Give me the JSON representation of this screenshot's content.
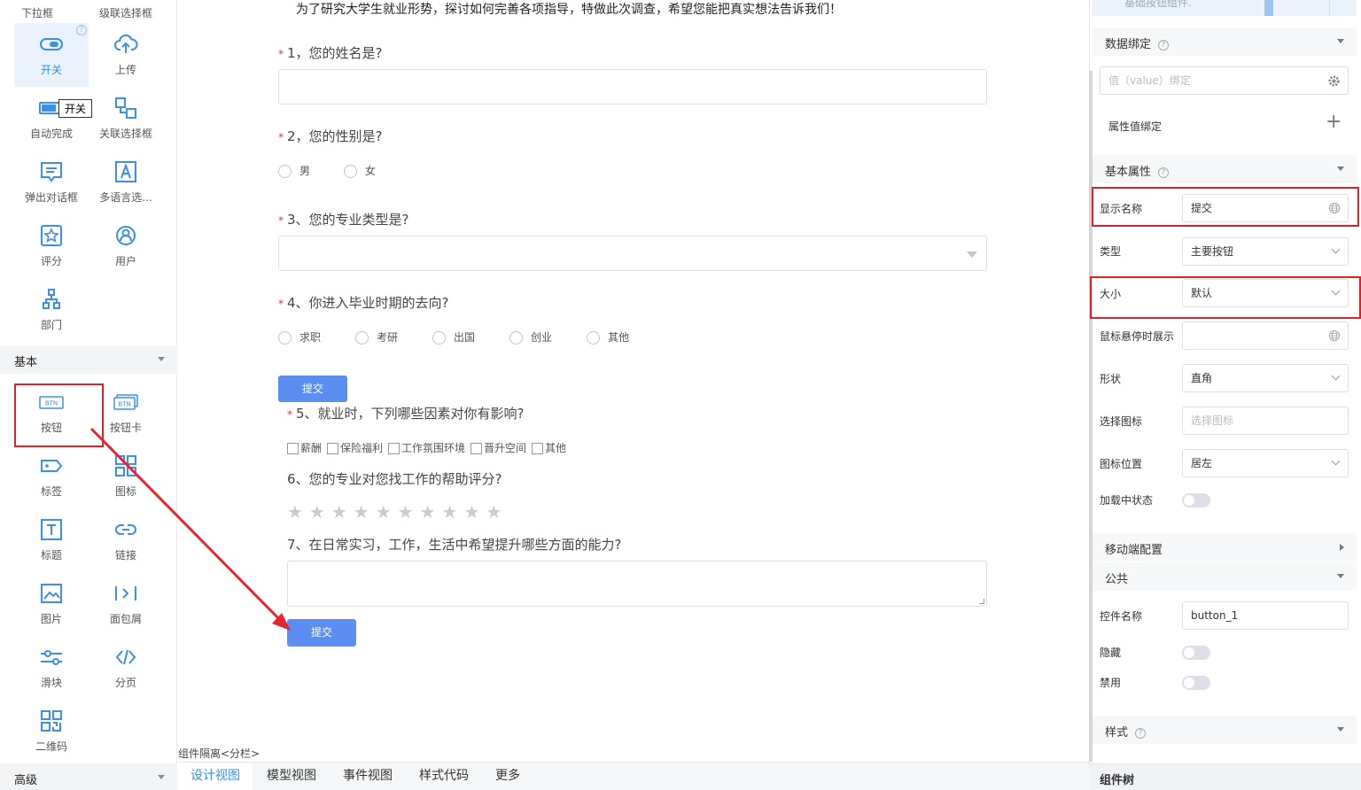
{
  "palette": {
    "top_labels": [
      "下拉框",
      "级联选择框"
    ],
    "items_a": [
      {
        "label": "开关",
        "icon": "switch-icon"
      },
      {
        "label": "上传",
        "icon": "cloud-upload-icon"
      },
      {
        "label": "自动完成",
        "icon": "autocomplete-icon"
      },
      {
        "label": "关联选择框",
        "icon": "related-select-icon"
      },
      {
        "label": "弹出对话框",
        "icon": "dialog-icon"
      },
      {
        "label": "多语言选...",
        "icon": "multilang-icon"
      },
      {
        "label": "评分",
        "icon": "star-rating-icon"
      },
      {
        "label": "用户",
        "icon": "user-icon"
      },
      {
        "label": "部门",
        "icon": "department-icon"
      }
    ],
    "tooltip": "开关",
    "section_basic": "基本",
    "items_b": [
      {
        "label": "按钮",
        "icon": "button-icon"
      },
      {
        "label": "按钮卡",
        "icon": "button-card-icon"
      },
      {
        "label": "标签",
        "icon": "tag-icon"
      },
      {
        "label": "图标",
        "icon": "grid-icon"
      },
      {
        "label": "标题",
        "icon": "title-icon"
      },
      {
        "label": "链接",
        "icon": "link-icon"
      },
      {
        "label": "图片",
        "icon": "image-icon"
      },
      {
        "label": "面包屑",
        "icon": "breadcrumb-icon"
      },
      {
        "label": "滑块",
        "icon": "slider-icon"
      },
      {
        "label": "分页",
        "icon": "pagination-icon"
      },
      {
        "label": "二维码",
        "icon": "qrcode-icon"
      }
    ],
    "section_advanced": "高级",
    "btn_text": "BTN"
  },
  "form": {
    "intro": "为了研究大学生就业形势，探讨如何完善各项指导，特做此次调查，希望您能把真实想法告诉我们！",
    "required_mark": "*",
    "q1": "1，您的姓名是?",
    "q2": "2，您的性别是?",
    "q2_options": [
      "男",
      "女"
    ],
    "q3": "3、您的专业类型是?",
    "q4": "4、你进入毕业时期的去向?",
    "q4_options": [
      "求职",
      "考研",
      "出国",
      "创业",
      "其他"
    ],
    "submit_1": "提交",
    "q5": "5、就业时，下列哪些因素对你有影响?",
    "q5_options": [
      "薪酬",
      "保险福利",
      "工作氛围环境",
      "晋升空间",
      "其他"
    ],
    "q6": "6、您的专业对您找工作的帮助评分?",
    "q6_stars": "★★★★★★★★★★",
    "q7": "7、在日常实习，工作，生活中希望提升哪些方面的能力?",
    "submit_2": "提交",
    "split_label": "组件隔离<分栏>"
  },
  "tabs": [
    "设计视图",
    "模型视图",
    "事件视图",
    "样式代码",
    "更多"
  ],
  "props": {
    "preview_text": "基础按钮组件.",
    "data_binding": "数据绑定",
    "value_binding_placeholder": "值（value）绑定",
    "attr_binding": "属性值绑定",
    "plus": "+",
    "basic_props": "基本属性",
    "display_name_label": "显示名称",
    "display_name_value": "提交",
    "type_label": "类型",
    "type_value": "主要按钮",
    "size_label": "大小",
    "size_value": "默认",
    "hover_label": "鼠标悬停时展示",
    "shape_label": "形状",
    "shape_value": "直角",
    "icon_label": "选择图标",
    "icon_placeholder": "选择图标",
    "icon_pos_label": "图标位置",
    "icon_pos_value": "居左",
    "loading_label": "加载中状态",
    "mobile_config": "移动端配置",
    "public": "公共",
    "control_name_label": "控件名称",
    "control_name_value": "button_1",
    "hidden_label": "隐藏",
    "disabled_label": "禁用",
    "style": "样式",
    "component_tree": "组件树",
    "help": "?"
  },
  "colors": {
    "accent": "#3b8fe6",
    "primary_button": "#5b8ef0",
    "annotation_red": "#d9232b"
  }
}
